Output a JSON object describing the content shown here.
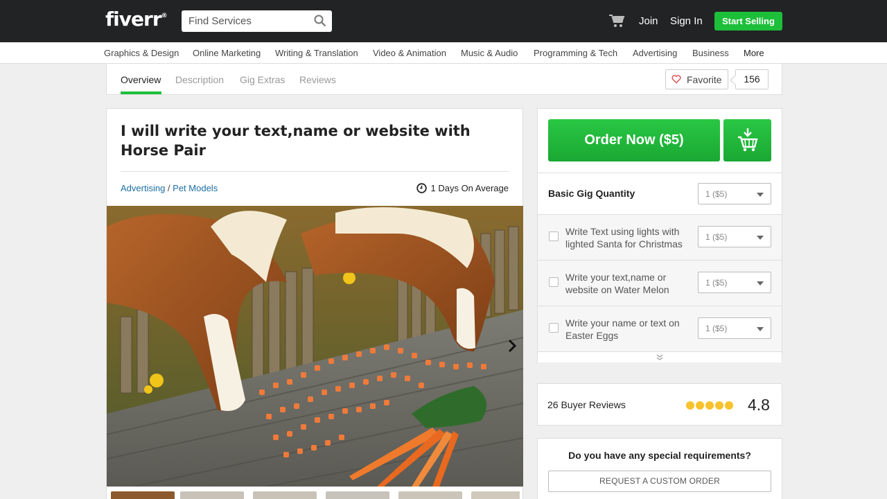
{
  "header": {
    "logo": "fiverr",
    "logo_mark": "®",
    "search_placeholder": "Find Services",
    "join": "Join",
    "sign_in": "Sign In",
    "start_selling": "Start Selling",
    "accent": "#1dbf3a"
  },
  "categories": [
    "Graphics & Design",
    "Online Marketing",
    "Writing & Translation",
    "Video & Animation",
    "Music & Audio",
    "Programming & Tech",
    "Advertising",
    "Business",
    "More"
  ],
  "gig_tabs": {
    "tabs": [
      "Overview",
      "Description",
      "Gig Extras",
      "Reviews"
    ],
    "active": "Overview",
    "favorite_label": "Favorite",
    "favorite_count": "156"
  },
  "gig": {
    "title": "I will write your text,name or website with Horse Pair",
    "category": "Advertising",
    "category_sep": " / ",
    "subcategory": "Pet Models",
    "delivery": "1 Days On Average"
  },
  "order": {
    "order_button": "Order Now ($5)",
    "basic_label": "Basic Gig Quantity",
    "basic_qty": "1 ($5)",
    "extras": [
      {
        "label": "Write Text using lights with lighted Santa for Christmas",
        "qty": "1 ($5)"
      },
      {
        "label": "Write your text,name or website on Water Melon",
        "qty": "1 ($5)"
      },
      {
        "label": "Write your name or text on Easter Eggs",
        "qty": "1 ($5)"
      }
    ]
  },
  "reviews": {
    "count_label": "26 Buyer Reviews",
    "rating": "4.8",
    "star_color": "#f7c22b"
  },
  "requirements": {
    "question": "Do you have any special requirements?",
    "button": "REQUEST A CUSTOM ORDER"
  }
}
